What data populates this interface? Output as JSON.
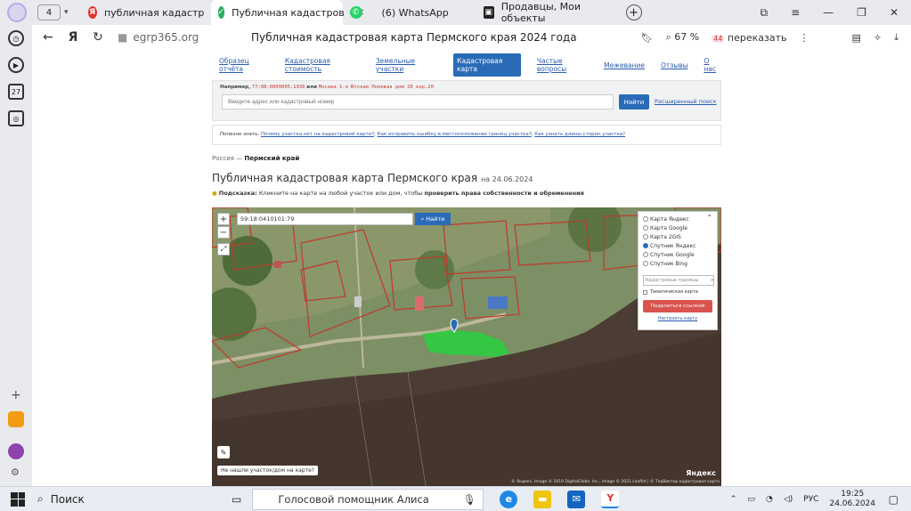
{
  "browser": {
    "tab_count": "4",
    "tabs": [
      {
        "label": "публичная кадастровая п",
        "favicon": "yandex-icon",
        "active": false
      },
      {
        "label": "Публичная кадастров",
        "favicon": "check-icon",
        "active": true
      },
      {
        "label": "(6) WhatsApp",
        "favicon": "whatsapp-icon",
        "active": false
      },
      {
        "label": "Продавцы, Мои объекты",
        "favicon": "avito-icon",
        "active": false
      }
    ],
    "url": "egrp365.org",
    "page_title": "Публичная кадастровая карта Пермского края 2024 года",
    "zoom": "67 %",
    "translate_label": "переказать",
    "translate_badge": "44"
  },
  "site": {
    "nav": [
      {
        "label": "Образец отчёта",
        "active": false
      },
      {
        "label": "Кадастровая стоимость",
        "active": false
      },
      {
        "label": "Земельные участки",
        "active": false
      },
      {
        "label": "Кадастровая карта",
        "active": true
      },
      {
        "label": "Частые вопросы",
        "active": false
      },
      {
        "label": "Межевание",
        "active": false
      },
      {
        "label": "Отзывы",
        "active": false
      },
      {
        "label": "О нас",
        "active": false
      }
    ],
    "search_hint_prefix": "Например,",
    "search_hint_example1": "77:08:0009005:1936",
    "search_hint_or": "или",
    "search_hint_example2": "Москва 1-я Ютская Полевая дом 20 кор.20",
    "search_placeholder": "Введите адрес или кадастровый номер",
    "search_button": "Найти",
    "advanced_search": "Расширенный поиск",
    "useful_prefix": "Полезно знать:",
    "useful_links": [
      "Почему участка нет на кадастровой карте?",
      "Как исправить ошибку в местоположении границ участка?",
      "Как узнать длины сторон участка?"
    ],
    "breadcrumb_root": "Россия",
    "breadcrumb_current": "Пермский край",
    "heading": "Публичная кадастровая карта Пермского края",
    "heading_date": "на 24.06.2024",
    "tip_label": "Подсказка:",
    "tip_text": "Кликните на карте на любой участок или дом, чтобы",
    "tip_bold": "проверить права собственности и обременения"
  },
  "map": {
    "search_value": "59:18:0410101:79",
    "search_button": "Найти",
    "layers": [
      {
        "label": "Карта Яндекс",
        "selected": false
      },
      {
        "label": "Карта Google",
        "selected": false
      },
      {
        "label": "Карта 2GIS",
        "selected": false
      },
      {
        "label": "Спутник Яндекс",
        "selected": true
      },
      {
        "label": "Спутник Google",
        "selected": false
      },
      {
        "label": "Спутник Bing",
        "selected": false
      }
    ],
    "overlay_select": "Кадастровые границы",
    "thematic_label": "Тематическая карта",
    "share_button": "Поделиться ссылкой",
    "reset_link": "Настроить карту",
    "not_found_label": "Не нашли участок/дом на карте?",
    "copyright": "© Яндекс, Image © 2019 DigitalGlobe, Inc., Image © 2021 Leaflet | © ТерВиктор кадастровая карта",
    "logo": "Яндекс",
    "zoom_in": "+",
    "zoom_out": "−"
  },
  "taskbar": {
    "search_label": "Поиск",
    "assistant_label": "Голосовой помощник Алиса",
    "lang": "РУС",
    "time": "19:25",
    "date": "24.06.2024"
  },
  "colors": {
    "accent": "#2a6bb8",
    "parcel_highlight": "#2ecc40",
    "parcel_border": "#c0392b"
  }
}
